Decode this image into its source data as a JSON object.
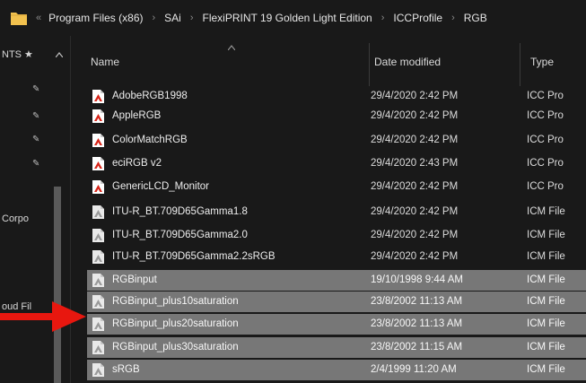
{
  "address_bar": {
    "crumbs": [
      "Program Files (x86)",
      "SAi",
      "FlexiPRINT 19 Golden Light Edition",
      "ICCProfile",
      "RGB"
    ],
    "lead": "«"
  },
  "nav": {
    "items": [
      {
        "label": "NTS ★"
      },
      {
        "label": "Corpo"
      },
      {
        "label": "oud Fil"
      }
    ]
  },
  "columns": {
    "name": "Name",
    "date": "Date modified",
    "type": "Type"
  },
  "files": [
    {
      "name": "AdobeRGB1998",
      "date": "29/4/2020 2:42 PM",
      "type": "ICC Pro",
      "icon": "icc-red",
      "selected": false
    },
    {
      "name": "AppleRGB",
      "date": "29/4/2020 2:42 PM",
      "type": "ICC Pro",
      "icon": "icc-red",
      "selected": false
    },
    {
      "name": "ColorMatchRGB",
      "date": "29/4/2020 2:42 PM",
      "type": "ICC Pro",
      "icon": "icc-red",
      "selected": false
    },
    {
      "name": "eciRGB v2",
      "date": "29/4/2020 2:43 PM",
      "type": "ICC Pro",
      "icon": "icc-red",
      "selected": false
    },
    {
      "name": "GenericLCD_Monitor",
      "date": "29/4/2020 2:42 PM",
      "type": "ICC Pro",
      "icon": "icc-red",
      "selected": false
    },
    {
      "name": "ITU-R_BT.709D65Gamma1.8",
      "date": "29/4/2020 2:42 PM",
      "type": "ICM File",
      "icon": "icm",
      "selected": false
    },
    {
      "name": "ITU-R_BT.709D65Gamma2.0",
      "date": "29/4/2020 2:42 PM",
      "type": "ICM File",
      "icon": "icm",
      "selected": false
    },
    {
      "name": "ITU-R_BT.709D65Gamma2.2sRGB",
      "date": "29/4/2020 2:42 PM",
      "type": "ICM File",
      "icon": "icm",
      "selected": false
    },
    {
      "name": "RGBinput",
      "date": "19/10/1998 9:44 AM",
      "type": "ICM File",
      "icon": "icm",
      "selected": true
    },
    {
      "name": "RGBinput_plus10saturation",
      "date": "23/8/2002 11:13 AM",
      "type": "ICM File",
      "icon": "icm",
      "selected": true
    },
    {
      "name": "RGBinput_plus20saturation",
      "date": "23/8/2002 11:13 AM",
      "type": "ICM File",
      "icon": "icm",
      "selected": true
    },
    {
      "name": "RGBinput_plus30saturation",
      "date": "23/8/2002 11:15 AM",
      "type": "ICM File",
      "icon": "icm",
      "selected": true
    },
    {
      "name": "sRGB",
      "date": "2/4/1999 11:20 AM",
      "type": "ICM File",
      "icon": "icm",
      "selected": true
    }
  ],
  "colors": {
    "background": "#191919",
    "selection": "#777777",
    "arrow": "#e8170f",
    "folder": "#f2c14e"
  }
}
